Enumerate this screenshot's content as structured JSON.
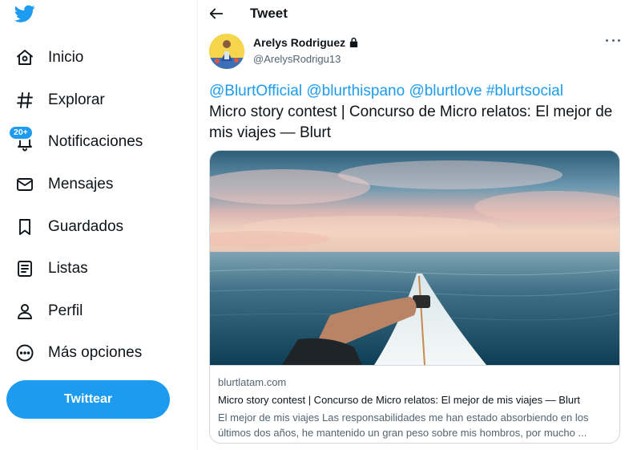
{
  "sidebar": {
    "items": [
      {
        "label": "Inicio",
        "icon": "home-icon"
      },
      {
        "label": "Explorar",
        "icon": "hashtag-icon"
      },
      {
        "label": "Notificaciones",
        "icon": "bell-icon",
        "badge": "20+"
      },
      {
        "label": "Mensajes",
        "icon": "envelope-icon"
      },
      {
        "label": "Guardados",
        "icon": "bookmark-icon"
      },
      {
        "label": "Listas",
        "icon": "list-icon"
      },
      {
        "label": "Perfil",
        "icon": "person-icon"
      },
      {
        "label": "Más opciones",
        "icon": "more-circle-icon"
      }
    ],
    "tweet_button": "Twittear"
  },
  "header": {
    "title": "Tweet"
  },
  "tweet": {
    "author_name": "Arelys Rodriguez",
    "author_handle": "@ArelysRodrigu13",
    "mentions": [
      "@BlurtOfficial",
      "@blurthispano",
      "@blurtlove",
      "#blurtsocial"
    ],
    "text": "Micro story contest | Concurso de Micro relatos: El mejor de mis viajes — Blurt",
    "card": {
      "domain": "blurtlatam.com",
      "title": "Micro story contest | Concurso de Micro relatos: El mejor de mis viajes — Blurt",
      "description": "El mejor de mis viajes Las responsabilidades me han estado absorbiendo en los últimos dos años, he mantenido un gran peso sobre mis hombros, por mucho ..."
    }
  },
  "colors": {
    "accent": "#1d9bf0",
    "text": "#0f1419",
    "secondary_text": "#536471",
    "border": "#cfd9de"
  }
}
